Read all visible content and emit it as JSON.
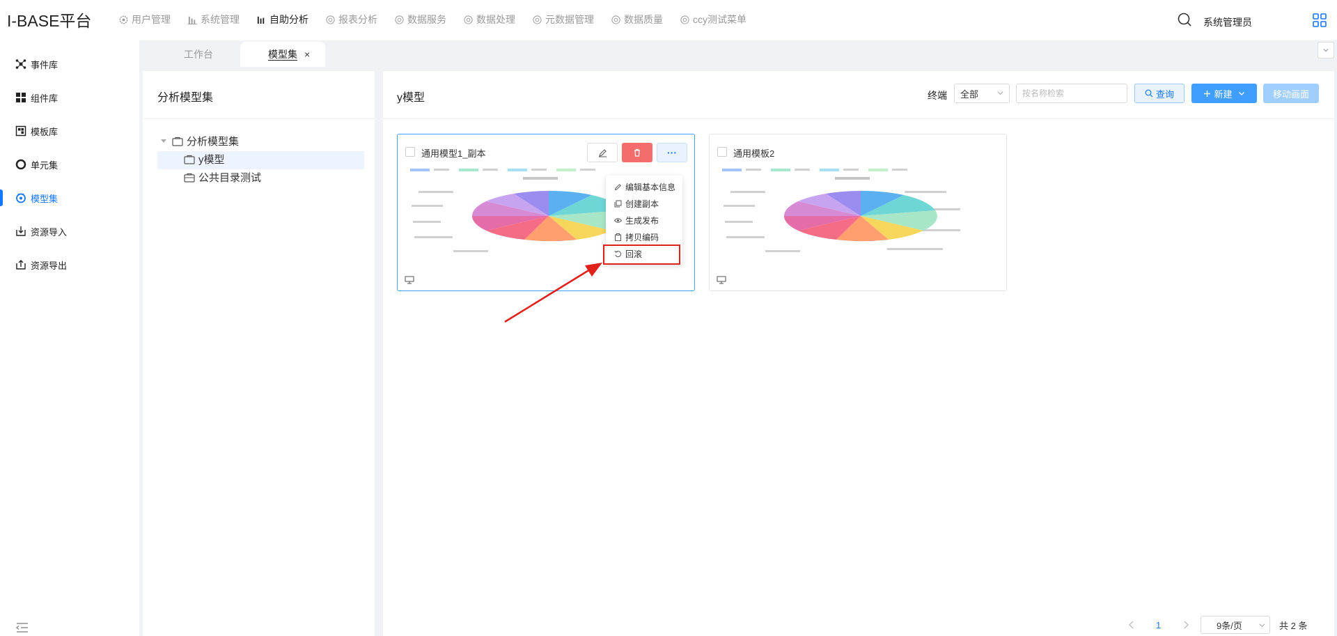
{
  "app": {
    "title": "I-BASE平台"
  },
  "topnav": [
    {
      "label": "用户管理",
      "icon": "gear-icon"
    },
    {
      "label": "系统管理",
      "icon": "bar-chart-icon"
    },
    {
      "label": "自助分析",
      "icon": "bar-chart-icon"
    },
    {
      "label": "报表分析",
      "icon": "gear-icon"
    },
    {
      "label": "数据服务",
      "icon": "gear-icon"
    },
    {
      "label": "数据处理",
      "icon": "gear-icon"
    },
    {
      "label": "元数据管理",
      "icon": "gear-icon"
    },
    {
      "label": "数据质量",
      "icon": "gear-icon"
    },
    {
      "label": "ccy测试菜单",
      "icon": "gear-icon"
    }
  ],
  "user": {
    "name": "系统管理员"
  },
  "sidebar": [
    {
      "label": "事件库",
      "icon": "network-icon"
    },
    {
      "label": "组件库",
      "icon": "grid-icon"
    },
    {
      "label": "模板库",
      "icon": "template-icon"
    },
    {
      "label": "单元集",
      "icon": "circle-icon"
    },
    {
      "label": "模型集",
      "icon": "model-icon"
    },
    {
      "label": "资源导入",
      "icon": "import-icon"
    },
    {
      "label": "资源导出",
      "icon": "export-icon"
    }
  ],
  "tabs": [
    {
      "label": "工作台"
    },
    {
      "label": "模型集",
      "close": "×"
    }
  ],
  "left_panel": {
    "title": "分析模型集",
    "tree": [
      {
        "label": "分析模型集"
      },
      {
        "label": "y模型"
      },
      {
        "label": "公共目录测试"
      }
    ]
  },
  "main": {
    "title": "y模型",
    "filter_label": "终端",
    "filter_value": "全部",
    "search_placeholder": "按名称检索",
    "query_label": "查询",
    "new_label": "新建",
    "move_label": "移动画面"
  },
  "cards": [
    {
      "title": "通用模型1_副本"
    },
    {
      "title": "通用模板2"
    }
  ],
  "menu": [
    {
      "label": "编辑基本信息",
      "icon": "edit-icon"
    },
    {
      "label": "创建副本",
      "icon": "copy-icon"
    },
    {
      "label": "生成发布",
      "icon": "eye-icon"
    },
    {
      "label": "拷贝编码",
      "icon": "clipboard-icon"
    },
    {
      "label": "回滚",
      "icon": "rollback-icon"
    }
  ],
  "pagination": {
    "page": "1",
    "page_size": "9条/页",
    "total": "共 2 条"
  },
  "colors": {
    "accent": "#1677ff",
    "primary_button": "#409eff",
    "danger": "#f56c6c",
    "highlight": "#e0201b"
  }
}
